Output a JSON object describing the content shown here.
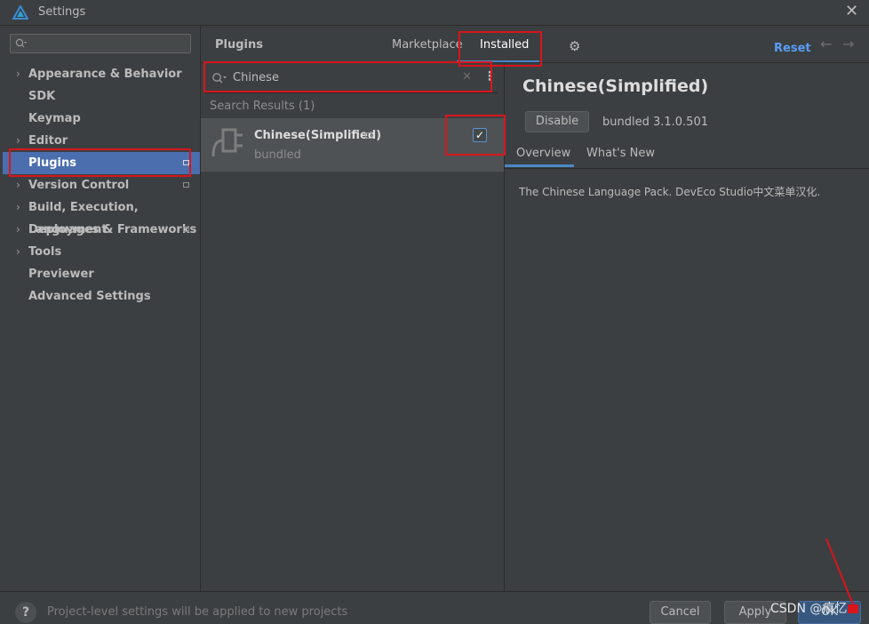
{
  "window": {
    "title": "Settings"
  },
  "sidebar": {
    "search_placeholder": "",
    "items": [
      {
        "label": "Appearance & Behavior",
        "expandable": true,
        "page_icon": false,
        "selected": false
      },
      {
        "label": "SDK",
        "expandable": false,
        "page_icon": false,
        "selected": false
      },
      {
        "label": "Keymap",
        "expandable": false,
        "page_icon": false,
        "selected": false
      },
      {
        "label": "Editor",
        "expandable": true,
        "page_icon": false,
        "selected": false
      },
      {
        "label": "Plugins",
        "expandable": false,
        "page_icon": true,
        "selected": true
      },
      {
        "label": "Version Control",
        "expandable": true,
        "page_icon": true,
        "selected": false
      },
      {
        "label": "Build, Execution, Deployment",
        "expandable": true,
        "page_icon": false,
        "selected": false
      },
      {
        "label": "Languages & Frameworks",
        "expandable": true,
        "page_icon": true,
        "selected": false
      },
      {
        "label": "Tools",
        "expandable": true,
        "page_icon": false,
        "selected": false
      },
      {
        "label": "Previewer",
        "expandable": false,
        "page_icon": false,
        "selected": false
      },
      {
        "label": "Advanced Settings",
        "expandable": false,
        "page_icon": false,
        "selected": false
      }
    ]
  },
  "header": {
    "title": "Plugins",
    "tabs": [
      "Marketplace",
      "Installed"
    ],
    "active_tab": "Installed",
    "reset_label": "Reset"
  },
  "search": {
    "value": "Chinese",
    "results_label": "Search Results (1)"
  },
  "plugins": [
    {
      "name": "Chinese(Simplified)",
      "subtitle": "bundled",
      "enabled": true
    }
  ],
  "detail": {
    "title": "Chinese(Simplified)",
    "disable_label": "Disable",
    "version": "bundled 3.1.0.501",
    "tabs": [
      "Overview",
      "What's New"
    ],
    "description": "The Chinese Language Pack. DevEco Studio中文菜单汉化."
  },
  "footer": {
    "help_label": "?",
    "note": "Project-level settings will be applied to new projects",
    "cancel_label": "Cancel",
    "apply_label": "Apply",
    "ok_label": "OK"
  },
  "watermark": "CSDN @痕忆丶",
  "colors": {
    "accent": "#4b6eaf",
    "link": "#589df6",
    "annotation": "#d8161c"
  }
}
